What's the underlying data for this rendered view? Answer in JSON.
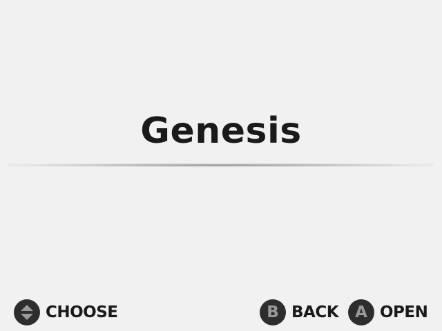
{
  "title": "Genesis",
  "footer": {
    "choose_label": "CHOOSE",
    "back_button_glyph": "B",
    "back_label": "BACK",
    "open_button_glyph": "A",
    "open_label": "OPEN"
  },
  "icons": {
    "choose": "dpad-up-down-icon",
    "back": "b-button-icon",
    "open": "a-button-icon"
  },
  "colors": {
    "background": "#f1f1f1",
    "text": "#1a1a1a",
    "button_fill": "#2d2d2d",
    "button_glyph": "#9a9a9a"
  }
}
